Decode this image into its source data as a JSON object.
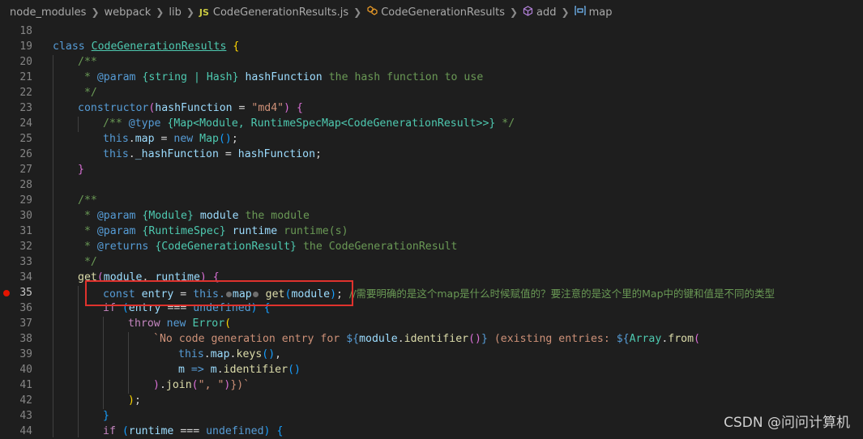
{
  "breadcrumb": {
    "items": [
      "node_modules",
      "webpack",
      "lib",
      "CodeGenerationResults.js",
      "CodeGenerationResults",
      "add",
      "map"
    ],
    "js_badge": "JS"
  },
  "breakpoint_line": "35",
  "watermark": "CSDN @问问计算机",
  "lines": [
    {
      "n": "18"
    },
    {
      "n": "19"
    },
    {
      "n": "20"
    },
    {
      "n": "21"
    },
    {
      "n": "22"
    },
    {
      "n": "23"
    },
    {
      "n": "24"
    },
    {
      "n": "25"
    },
    {
      "n": "26"
    },
    {
      "n": "27"
    },
    {
      "n": "28"
    },
    {
      "n": "29"
    },
    {
      "n": "30"
    },
    {
      "n": "31"
    },
    {
      "n": "32"
    },
    {
      "n": "33"
    },
    {
      "n": "34"
    },
    {
      "n": "35"
    },
    {
      "n": "36"
    },
    {
      "n": "37"
    },
    {
      "n": "38"
    },
    {
      "n": "39"
    },
    {
      "n": "40"
    },
    {
      "n": "41"
    },
    {
      "n": "42"
    },
    {
      "n": "43"
    },
    {
      "n": "44"
    }
  ],
  "code": {
    "l19_class": "class",
    "l19_name": "CodeGenerationResults",
    "l20": "/**",
    "l21_star": " * ",
    "l21_tag": "@param",
    "l21_type": "{string | Hash}",
    "l21_name": "hashFunction",
    "l21_desc": "the hash function to use",
    "l22": " */",
    "l23_ctor": "constructor",
    "l23_param": "hashFunction",
    "l23_str": "\"md4\"",
    "l24_open": "/** ",
    "l24_tag": "@type",
    "l24_type": "{Map<Module, RuntimeSpecMap<CodeGenerationResult>>}",
    "l24_close": " */",
    "l25_this": "this",
    "l25_prop": "map",
    "l25_new": "new",
    "l25_cls": "Map",
    "l26_this": "this",
    "l26_prop": "_hashFunction",
    "l26_val": "hashFunction",
    "l29": "/**",
    "l30_tag": "@param",
    "l30_type": "{Module}",
    "l30_name": "module",
    "l30_desc": "the module",
    "l31_tag": "@param",
    "l31_type": "{RuntimeSpec}",
    "l31_name": "runtime",
    "l31_desc": "runtime(s)",
    "l32_tag": "@returns",
    "l32_type": "{CodeGenerationResult}",
    "l32_desc": "the CodeGenerationResult",
    "l33": " */",
    "l34_get": "get",
    "l34_p1": "module",
    "l34_p2": "runtime",
    "l35_const": "const",
    "l35_var": "entry",
    "l35_this": "this.",
    "l35_map": "map",
    "l35_get": "get",
    "l35_arg": "module",
    "l35_comment": "//需要明确的是这个map是什么时候赋值的？要注意的是这个里的Map中的键和值是不同的类型",
    "l36_if": "if",
    "l36_var": "entry",
    "l36_undef": "undefined",
    "l37_throw": "throw",
    "l37_new": "new",
    "l37_err": "Error",
    "l38_str1": "`No code generation entry for ",
    "l38_tpl_open": "${",
    "l38_mod": "module",
    "l38_ident": "identifier",
    "l38_tpl_close": "}",
    "l38_str2": " (existing entries: ",
    "l38_arr": "Array",
    "l38_from": "from",
    "l39_this": "this",
    "l39_map": "map",
    "l39_keys": "keys",
    "l40_m": "m",
    "l40_m2": "m",
    "l40_ident": "identifier",
    "l41_join": "join",
    "l41_str": "\", \"",
    "l41_end": "})`",
    "l44_if": "if",
    "l44_var": "runtime",
    "l44_undef": "undefined"
  }
}
